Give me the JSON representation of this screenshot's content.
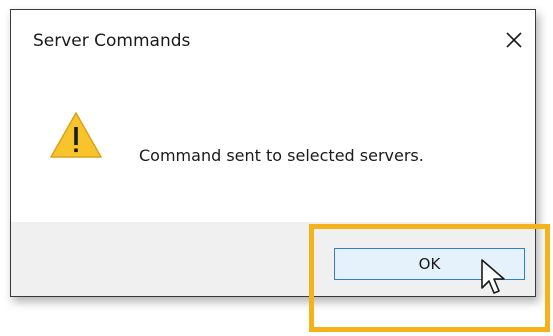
{
  "dialog": {
    "title": "Server Commands",
    "message": "Command sent to selected servers.",
    "ok_label": "OK",
    "icons": {
      "close": "close-icon",
      "warning": "warning-icon",
      "cursor": "mouse-pointer-icon"
    }
  },
  "colors": {
    "highlight": "#f4b31a",
    "warning_fill": "#f7c52b",
    "button_border": "#2d7fd3",
    "button_bg": "#e5f1fb",
    "footer_bg": "#f0f0f0"
  }
}
